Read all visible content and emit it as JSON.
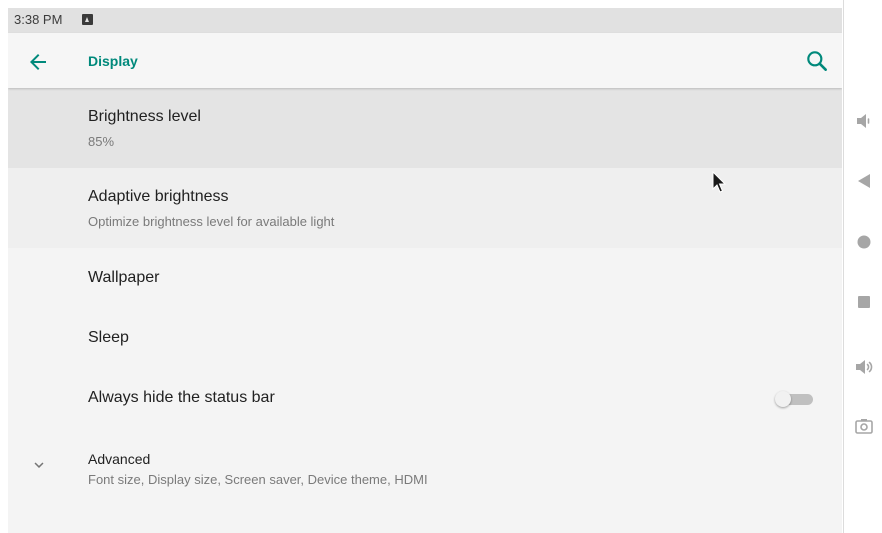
{
  "status_bar": {
    "time": "3:38 PM"
  },
  "app_bar": {
    "title": "Display"
  },
  "settings": [
    {
      "title": "Brightness level",
      "summary": "85%"
    },
    {
      "title": "Adaptive brightness",
      "summary": "Optimize brightness level for available light"
    },
    {
      "title": "Wallpaper"
    },
    {
      "title": "Sleep"
    },
    {
      "title": "Always hide the status bar",
      "toggle_on": false
    }
  ],
  "advanced": {
    "title": "Advanced",
    "summary": "Font size, Display size, Screen saver, Device theme, HDMI"
  },
  "icons": {
    "back": "arrow-back-icon",
    "search": "search-icon",
    "expand": "chevron-down-icon",
    "nav": [
      "volume-down-icon",
      "back-triangle-icon",
      "home-circle-icon",
      "recents-square-icon",
      "volume-up-icon",
      "camera-icon"
    ]
  },
  "colors": {
    "accent": "#00897b",
    "status_bar": "#e1e1e1",
    "highlight_row": "#e4e4e4",
    "nav_icon": "#a6a6a6"
  }
}
